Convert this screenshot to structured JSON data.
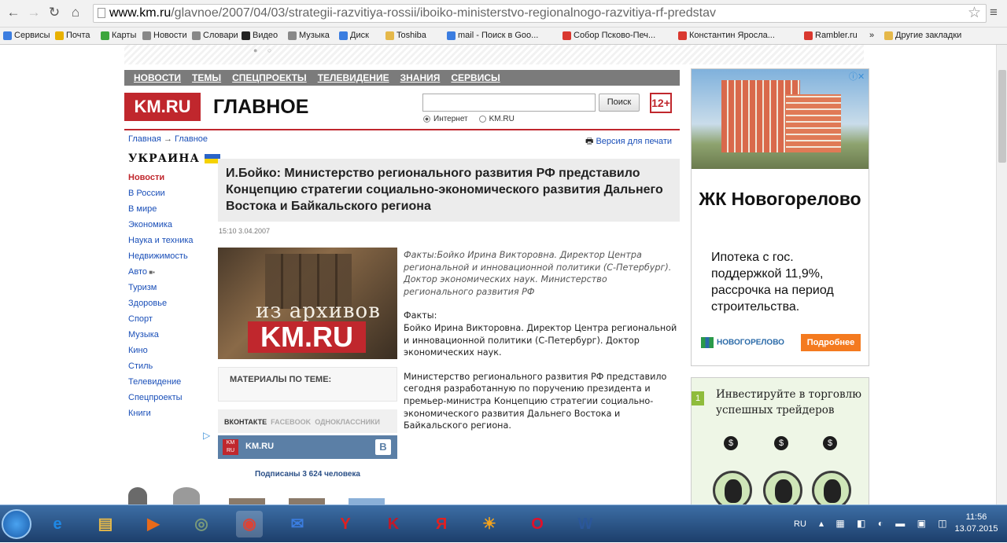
{
  "browser": {
    "url_host": "www.km.ru",
    "url_path": "/glavnoe/2007/04/03/strategii-razvitiya-rossii/iboiko-ministerstvo-regionalnogo-razvitiya-rf-predstav"
  },
  "bookmarks": [
    {
      "label": "Сервисы",
      "icon": "apps-icon",
      "color": "#3b7de0"
    },
    {
      "label": "Почта",
      "icon": "yandex-mail-icon",
      "color": "#e8b100"
    },
    {
      "label": "Карты",
      "icon": "maps-icon",
      "color": "#3da63d"
    },
    {
      "label": "Новости",
      "icon": "page-icon",
      "color": "#888888"
    },
    {
      "label": "Словари",
      "icon": "page-icon",
      "color": "#888888"
    },
    {
      "label": "Видео",
      "icon": "play-icon",
      "color": "#222222"
    },
    {
      "label": "Музыка",
      "icon": "music-icon",
      "color": "#888888"
    },
    {
      "label": "Диск",
      "icon": "disk-icon",
      "color": "#3b7de0"
    },
    {
      "label": "Toshiba",
      "icon": "folder-icon",
      "color": "#e5b84a"
    },
    {
      "label": "mail - Поиск в Goo...",
      "icon": "google-icon",
      "color": "#3b7de0"
    },
    {
      "label": "Собор Псково-Печ...",
      "icon": "yandex-icon",
      "color": "#d9382f"
    },
    {
      "label": "Константин Яросла...",
      "icon": "yandex-icon",
      "color": "#d9382f"
    },
    {
      "label": "Rambler.ru",
      "icon": "yandex-icon",
      "color": "#d9382f"
    },
    {
      "label": "»",
      "icon": "",
      "color": ""
    },
    {
      "label": "Другие закладки",
      "icon": "folder-icon",
      "color": "#e5b84a"
    }
  ],
  "site": {
    "nav": [
      "НОВОСТИ",
      "ТЕМЫ",
      "СПЕЦПРОЕКТЫ",
      "ТЕЛЕВИДЕНИЕ",
      "ЗНАНИЯ",
      "СЕРВИСЫ"
    ],
    "logo_km": "KM",
    "logo_ru": ".RU",
    "section_title": "ГЛАВНОЕ",
    "search_button": "Поиск",
    "age_rating": "12+",
    "radio_internet": "Интернет",
    "radio_kmru": "KM.RU",
    "breadcrumb_home": "Главная",
    "breadcrumb_arrow": "→",
    "breadcrumb_section": "Главное",
    "print_version": "Версия для печати",
    "region_logo": "УКРАИНА",
    "side_menu": [
      "Новости",
      "В России",
      "В мире",
      "Экономика",
      "Наука и техника",
      "Недвижимость",
      "Авто",
      "Туризм",
      "Здоровье",
      "Спорт",
      "Музыка",
      "Кино",
      "Стиль",
      "Телевидение",
      "Спецпроекты",
      "Книги"
    ]
  },
  "article": {
    "title": "И.Бойко: Министерство регионального развития РФ представило Концепцию стратегии социально-экономического развития Дальнего Востока и Байкальского региона",
    "date": "15:10  3.04.2007",
    "image_line1": "из архивов",
    "image_line2": "KM.RU",
    "lead": "Факты:Бойко Ирина Викторовна. Директор Центра региональной и инновационной политики (С-Петербург). Доктор экономических наук. Министерство регионального развития РФ",
    "para1": "Факты:\nБойко Ирина Викторовна. Директор Центра региональной и инновационной политики (С-Петербург). Доктор экономических наук.",
    "para2": "Министерство регионального развития РФ представило сегодня разработанную по поручению президента и премьер-министра Концепцию стратегии социально-экономического развития Дальнего Востока и Байкальского региона.",
    "materials_title": "МАТЕРИАЛЫ ПО ТЕМЕ:",
    "social_tabs": [
      "ВКОНТАКТЕ",
      "FACEBOOK",
      "ОДНОКЛАССНИКИ"
    ],
    "vk_name": "KM.RU",
    "vk_letter": "B",
    "subscribers": "Подписаны 3 624 человека"
  },
  "ads": {
    "ad1_title": "ЖК Новогорелово",
    "ad1_text": "Ипотека с гос. поддержкой 11,9%, рассрочка на период строительства.",
    "ad1_logo": "НОВОГОРЕЛОВО",
    "ad1_button": "Подробнее",
    "ad2_number": "1",
    "ad2_text": "Инвестируйте в торговлю успешных трейдеров",
    "coin_symbol": "$"
  },
  "taskbar": {
    "apps": [
      {
        "name": "ie-icon",
        "glyph": "e",
        "color": "#1e88e5"
      },
      {
        "name": "explorer-icon",
        "glyph": "▤",
        "color": "#e5b84a"
      },
      {
        "name": "media-player-icon",
        "glyph": "▶",
        "color": "#e86a1a"
      },
      {
        "name": "disk-utility-icon",
        "glyph": "◎",
        "color": "#7a9a7a"
      },
      {
        "name": "chrome-icon",
        "glyph": "◉",
        "color": "#db4437"
      },
      {
        "name": "mail-icon",
        "glyph": "✉",
        "color": "#3b7de0"
      },
      {
        "name": "yandex-browser-icon",
        "glyph": "Y",
        "color": "#e02020"
      },
      {
        "name": "kaspersky-icon",
        "glyph": "K",
        "color": "#c01a2a"
      },
      {
        "name": "yandex-icon",
        "glyph": "Я",
        "color": "#e02020"
      },
      {
        "name": "sun-app-icon",
        "glyph": "☀",
        "color": "#f2a21e"
      },
      {
        "name": "opera-icon",
        "glyph": "O",
        "color": "#e0102a"
      },
      {
        "name": "word-icon",
        "glyph": "W",
        "color": "#2b579a"
      }
    ],
    "lang": "RU",
    "time": "11:56",
    "date": "13.07.2015"
  }
}
